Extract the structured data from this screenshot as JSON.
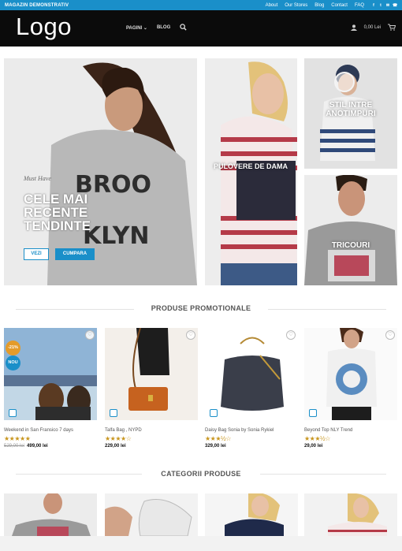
{
  "topbar": {
    "store_name": "MAGAZIN DEMONSTRATIV",
    "links": [
      "About",
      "Our Stores",
      "Blog",
      "Contact",
      "FAQ"
    ]
  },
  "header": {
    "logo": "Logo",
    "nav": [
      "PAGINI",
      "BLOG"
    ],
    "cart": "0,00 Lei"
  },
  "banners": {
    "hero": {
      "subtitle": "Must Have",
      "title": "CELE MAI RECENTE TENDINTE",
      "btn1": "VEZI",
      "btn2": "CUMPARA"
    },
    "b2": {
      "title": "PULOVERE DE DAMA"
    },
    "b3": {
      "title": "STIL INTRE ANOTIMPURI"
    },
    "b4": {
      "title": "TRICOURI"
    }
  },
  "sections": {
    "promo": "PRODUSE PROMOTIONALE",
    "categories": "CATEGORII PRODUSE"
  },
  "products": [
    {
      "name": "Weekend in San Fransico 7 days",
      "rating": 5,
      "stars": "★★★★★",
      "old_price": "529,00 lei",
      "price": "499,00 lei",
      "badge1": "-21%",
      "badge2": "NOU"
    },
    {
      "name": "Talfa Bag , NYPD",
      "rating": 4,
      "stars": "★★★★☆",
      "price": "229,00 lei"
    },
    {
      "name": "Daisy Bag Sonia by Sonia Rykiel",
      "rating": 3.5,
      "stars": "★★★½☆",
      "price": "329,00 lei"
    },
    {
      "name": "Beyond Top NLY Trend",
      "rating": 3.5,
      "stars": "★★★½☆",
      "price": "29,00 lei"
    }
  ],
  "colors": {
    "accent": "#1a8fc9",
    "header_bg": "#0b0b0b",
    "star": "#c8951c"
  }
}
